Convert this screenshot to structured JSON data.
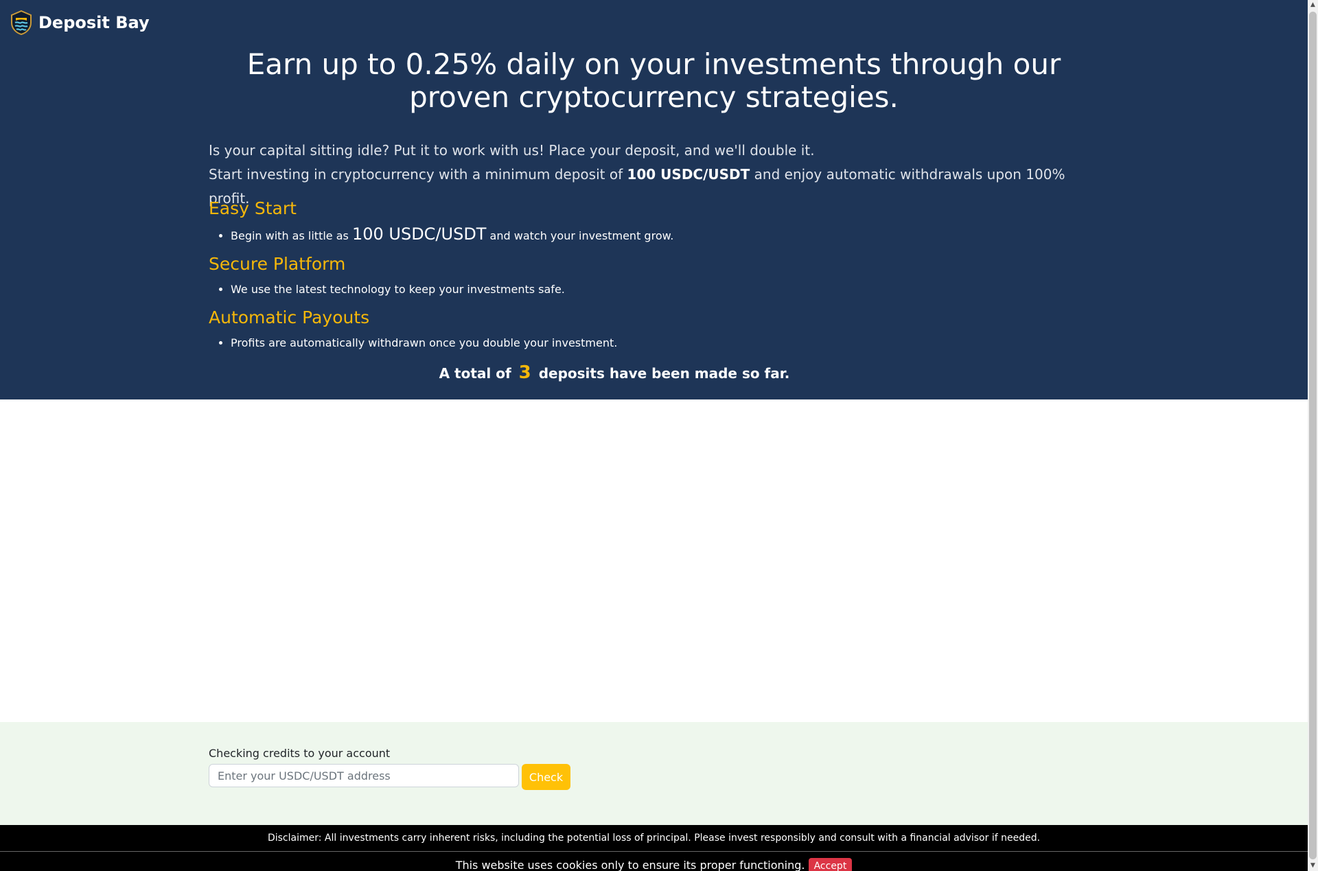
{
  "brand": {
    "name": "Deposit Bay",
    "logo_icon": "shield-waves-icon"
  },
  "hero": {
    "headline": "Earn up to 0.25% daily on your investments through our proven cryptocurrency strategies.",
    "intro_line1": "Is your capital sitting idle? Put it to work with us! Place your deposit, and we'll double it.",
    "intro_line2_pre": "Start investing in cryptocurrency with a minimum deposit of ",
    "intro_line2_bold": "100 USDC/USDT",
    "intro_line2_post": " and enjoy automatic withdrawals upon 100% profit."
  },
  "features": [
    {
      "title": "Easy Start",
      "text_pre": "Begin with as little as ",
      "text_big": "100 USDC/USDT",
      "text_post": " and watch your investment grow."
    },
    {
      "title": "Secure Platform",
      "text": "We use the latest technology to keep your investments safe."
    },
    {
      "title": "Automatic Payouts",
      "text": "Profits are automatically withdrawn once you double your investment."
    }
  ],
  "total": {
    "pre": "A total of",
    "count": "3",
    "post": "deposits have been made so far."
  },
  "credits": {
    "label": "Checking credits to your account",
    "placeholder": "Enter your USDC/USDT address",
    "button": "Check"
  },
  "disclaimer": "Disclaimer: All investments carry inherent risks, including the potential loss of principal. Please invest responsibly and consult with a financial advisor if needed.",
  "cookie": {
    "text": "This website uses cookies only to ensure its proper functioning.",
    "button": "Accept"
  },
  "colors": {
    "hero_bg": "#1e3557",
    "accent": "#f5b70a",
    "check_button": "#ffc107",
    "accept_button": "#dc3545",
    "credits_bg": "#eef7ed"
  }
}
